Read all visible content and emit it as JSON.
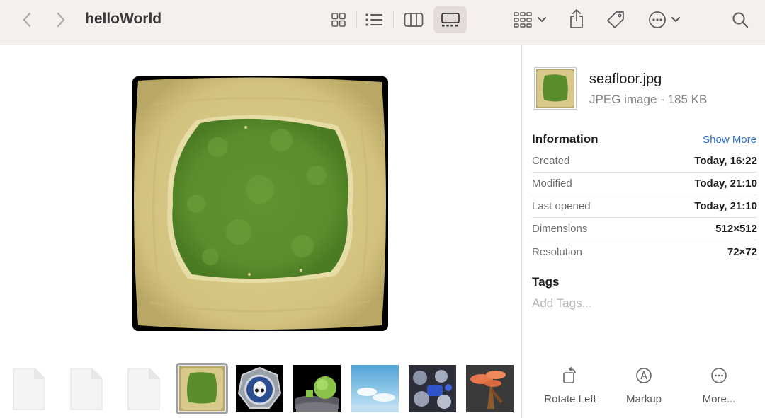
{
  "window": {
    "title": "helloWorld"
  },
  "toolbar": {
    "back_icon": "chevron-left-icon",
    "forward_icon": "chevron-right-icon",
    "views": [
      "icon-view",
      "list-view",
      "column-view",
      "gallery-view"
    ],
    "active_view": "gallery-view",
    "group_icon": "group-by-icon",
    "share_icon": "share-icon",
    "tag_icon": "tag-icon",
    "more_icon": "ellipsis-circle-icon",
    "search_icon": "search-icon"
  },
  "inspector": {
    "file_name": "seafloor.jpg",
    "file_kind": "JPEG image - 185 KB",
    "information_title": "Information",
    "show_more": "Show More",
    "info": [
      {
        "key": "Created",
        "value": "Today, 16:22"
      },
      {
        "key": "Modified",
        "value": "Today, 21:10"
      },
      {
        "key": "Last opened",
        "value": "Today, 21:10"
      },
      {
        "key": "Dimensions",
        "value": "512×512"
      },
      {
        "key": "Resolution",
        "value": "72×72"
      }
    ],
    "tags_title": "Tags",
    "tags_placeholder": "Add Tags...",
    "actions": [
      {
        "label": "Rotate Left",
        "icon": "rotate-left-icon"
      },
      {
        "label": "Markup",
        "icon": "markup-icon"
      },
      {
        "label": "More...",
        "icon": "more-icon"
      }
    ]
  },
  "colors": {
    "toolbar_bg": "#f6f0ec",
    "link": "#2a6fd6",
    "sand": "#d8c98a",
    "grass": "#5d8f2d"
  }
}
